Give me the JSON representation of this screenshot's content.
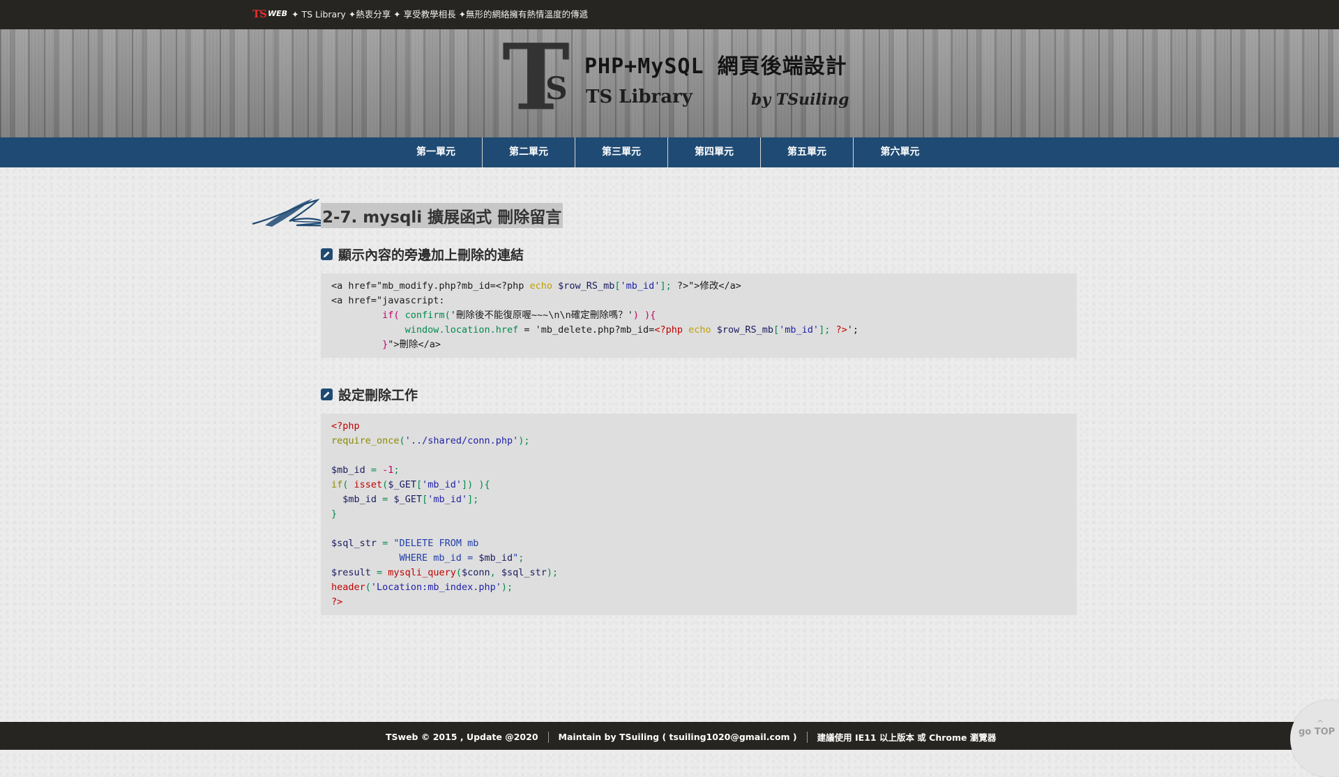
{
  "topbar": {
    "brand_ts": "TS",
    "brand_web": "WEB",
    "slogan": "✦ TS Library ✦熱衷分享 ✦ 享受教學相長 ✦無形的網絡擁有熱情溫度的傳遞"
  },
  "header": {
    "logo_t": "T",
    "logo_s": "S",
    "title": "PHP+MySQL 網頁後端設計",
    "subtitle": "TS Library",
    "byline": "by TSuiling"
  },
  "nav": {
    "items": [
      "第一單元",
      "第二單元",
      "第三單元",
      "第四單元",
      "第五單元",
      "第六單元"
    ]
  },
  "main": {
    "heading": "2-7. mysqli 擴展函式 刪除留言",
    "section1_title": "顯示內容的旁邊加上刪除的連結",
    "section2_title": "設定刪除工作",
    "code1": [
      [
        {
          "t": "<a href=\"mb_modify.php?mb_id=<?php ",
          "c": ""
        },
        {
          "t": "echo ",
          "c": "c-kw"
        },
        {
          "t": "$row_RS_mb",
          "c": "c-var"
        },
        {
          "t": "[",
          "c": "c-green"
        },
        {
          "t": "'mb_id'",
          "c": "c-str"
        },
        {
          "t": "]; ",
          "c": "c-green"
        },
        {
          "t": "?>\">修改</a>",
          "c": ""
        }
      ],
      [
        {
          "t": "<a href=\"javascript:",
          "c": ""
        }
      ],
      [
        {
          "t": "         ",
          "c": ""
        },
        {
          "t": "if( ",
          "c": "c-fn"
        },
        {
          "t": "confirm(",
          "c": "c-green"
        },
        {
          "t": "'刪除後不能復原喔~~~\\n\\n確定刪除嗎？'",
          "c": ""
        },
        {
          "t": ") ){",
          "c": "c-fn"
        }
      ],
      [
        {
          "t": "             ",
          "c": ""
        },
        {
          "t": "window.location.href",
          "c": "c-green"
        },
        {
          "t": " = 'mb_delete.php?mb_id=",
          "c": ""
        },
        {
          "t": "<?php ",
          "c": "c-red"
        },
        {
          "t": "echo ",
          "c": "c-kw"
        },
        {
          "t": "$row_RS_mb",
          "c": "c-var"
        },
        {
          "t": "[",
          "c": "c-green"
        },
        {
          "t": "'mb_id'",
          "c": "c-str"
        },
        {
          "t": "]; ",
          "c": "c-green"
        },
        {
          "t": "?>",
          "c": "c-red"
        },
        {
          "t": "';",
          "c": ""
        }
      ],
      [
        {
          "t": "         ",
          "c": ""
        },
        {
          "t": "}",
          "c": "c-fn"
        },
        {
          "t": "\">刪除</a>",
          "c": ""
        }
      ]
    ],
    "code2": [
      [
        {
          "t": "<?php",
          "c": "c-red"
        }
      ],
      [
        {
          "t": "require_once",
          "c": "c-olive"
        },
        {
          "t": "(",
          "c": "c-green"
        },
        {
          "t": "'../shared/conn.php'",
          "c": "c-str"
        },
        {
          "t": ");",
          "c": "c-green"
        }
      ],
      [
        {
          "t": "",
          "c": ""
        }
      ],
      [
        {
          "t": "$mb_id",
          "c": "c-var"
        },
        {
          "t": " = ",
          "c": "c-green"
        },
        {
          "t": "-1",
          "c": "c-fn"
        },
        {
          "t": ";",
          "c": "c-green"
        }
      ],
      [
        {
          "t": "if",
          "c": "c-olive"
        },
        {
          "t": "( ",
          "c": "c-green"
        },
        {
          "t": "isset",
          "c": "c-red"
        },
        {
          "t": "(",
          "c": "c-green"
        },
        {
          "t": "$_GET",
          "c": "c-var"
        },
        {
          "t": "[",
          "c": "c-green"
        },
        {
          "t": "'mb_id'",
          "c": "c-str"
        },
        {
          "t": "]) ){",
          "c": "c-green"
        }
      ],
      [
        {
          "t": "  ",
          "c": ""
        },
        {
          "t": "$mb_id",
          "c": "c-var"
        },
        {
          "t": " = ",
          "c": "c-green"
        },
        {
          "t": "$_GET",
          "c": "c-var"
        },
        {
          "t": "[",
          "c": "c-green"
        },
        {
          "t": "'mb_id'",
          "c": "c-str"
        },
        {
          "t": "];",
          "c": "c-green"
        }
      ],
      [
        {
          "t": "}",
          "c": "c-green"
        }
      ],
      [
        {
          "t": "",
          "c": ""
        }
      ],
      [
        {
          "t": "$sql_str",
          "c": "c-var"
        },
        {
          "t": " = ",
          "c": "c-green"
        },
        {
          "t": "\"DELETE FROM mb",
          "c": "c-blue"
        }
      ],
      [
        {
          "t": "            WHERE mb_id = ",
          "c": "c-blue"
        },
        {
          "t": "$mb_id",
          "c": "c-var"
        },
        {
          "t": "\"",
          "c": "c-blue"
        },
        {
          "t": ";",
          "c": "c-green"
        }
      ],
      [
        {
          "t": "$result",
          "c": "c-var"
        },
        {
          "t": " = ",
          "c": "c-green"
        },
        {
          "t": "mysqli_query",
          "c": "c-red"
        },
        {
          "t": "(",
          "c": "c-green"
        },
        {
          "t": "$conn",
          "c": "c-var"
        },
        {
          "t": ", ",
          "c": "c-green"
        },
        {
          "t": "$sql_str",
          "c": "c-var"
        },
        {
          "t": ");",
          "c": "c-green"
        }
      ],
      [
        {
          "t": "header",
          "c": "c-red"
        },
        {
          "t": "(",
          "c": "c-green"
        },
        {
          "t": "'Location:mb_index.php'",
          "c": "c-str"
        },
        {
          "t": ");",
          "c": "c-green"
        }
      ],
      [
        {
          "t": "?>",
          "c": "c-red"
        }
      ]
    ]
  },
  "footer": {
    "copyright": "TSweb © 2015 , Update @2020",
    "maintain": "Maintain by TSuiling ( tsuiling1020@gmail.com )",
    "browser_note": "建議使用 IE11 以上版本 或 Chrome 瀏覽器"
  },
  "gotop": {
    "arrow": "^",
    "label": "go TOP"
  },
  "colors": {
    "nav_bg": "#1f4a73",
    "topbar_bg": "#262521",
    "code_bg": "#dedede"
  }
}
